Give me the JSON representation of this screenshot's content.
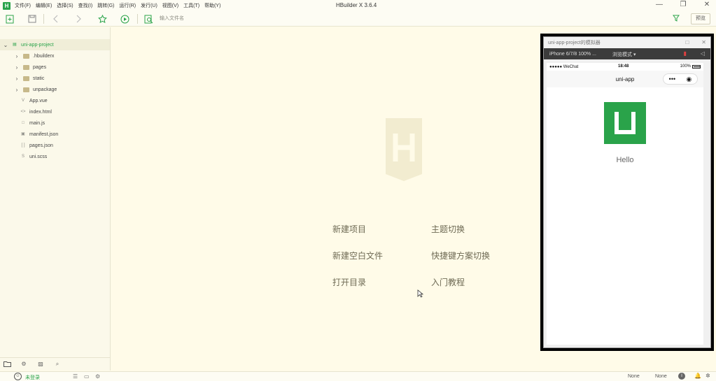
{
  "app": {
    "logo_letter": "H",
    "title": "HBuilder X 3.6.4"
  },
  "menu": [
    "文件(F)",
    "编辑(E)",
    "选择(S)",
    "查找(I)",
    "跳转(G)",
    "运行(R)",
    "发行(U)",
    "视图(V)",
    "工具(T)",
    "帮助(Y)"
  ],
  "window_controls": {
    "minimize": "—",
    "restore": "❐",
    "close": "✕"
  },
  "toolbar": {
    "file_search_placeholder": "输入文件名",
    "preview_label": "预览"
  },
  "explorer": {
    "root": "uni-app-project",
    "items": [
      {
        "label": ".hbuilderx",
        "type": "folder"
      },
      {
        "label": "pages",
        "type": "folder"
      },
      {
        "label": "static",
        "type": "folder"
      },
      {
        "label": "unpackage",
        "type": "folder"
      },
      {
        "label": "App.vue",
        "type": "file",
        "icon": "V"
      },
      {
        "label": "index.html",
        "type": "file",
        "icon": "<>"
      },
      {
        "label": "main.js",
        "type": "file",
        "icon": "□"
      },
      {
        "label": "manifest.json",
        "type": "file",
        "icon": "▣"
      },
      {
        "label": "pages.json",
        "type": "file",
        "icon": "[ ]"
      },
      {
        "label": "uni.scss",
        "type": "file",
        "icon": "S"
      }
    ]
  },
  "quick_start": {
    "new_project": "新建项目",
    "new_blank_file": "新建空白文件",
    "open_dir": "打开目录",
    "switch_theme": "主题切换",
    "switch_keymap": "快捷键方案切换",
    "tutorial": "入门教程"
  },
  "simulator": {
    "title": "uni-app-project的模拟器",
    "device": "iPhone 6/7/8 100% ...",
    "mode": "浏览模式 ▾",
    "status_left": "●●●●● WeChat",
    "status_time": "18:48",
    "status_battery": "100%",
    "nav_title": "uni-app",
    "capsule_dots": "•••",
    "page_text": "Hello"
  },
  "statusbar": {
    "login": "未登录",
    "lang_a": "None",
    "lang_b": "None"
  },
  "colors": {
    "brand": "#2aa34a",
    "editor_bg": "#fffbe8"
  }
}
